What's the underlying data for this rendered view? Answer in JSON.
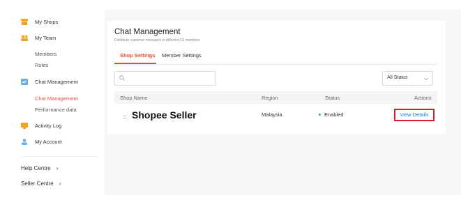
{
  "sidebar": {
    "items": [
      {
        "label": "My Shops",
        "icon": "shop-icon"
      },
      {
        "label": "My Team",
        "icon": "team-icon"
      },
      {
        "label": "Members"
      },
      {
        "label": "Roles"
      },
      {
        "label": "Chat Management",
        "icon": "chat-icon"
      },
      {
        "label": "Chat Management"
      },
      {
        "label": "Performance data"
      },
      {
        "label": "Activity Log",
        "icon": "activity-log-icon"
      },
      {
        "label": "My Account",
        "icon": "account-icon"
      }
    ],
    "help_centre": "Help Centre",
    "seller_centre": "Seller Centre",
    "chevron": "›"
  },
  "main": {
    "title": "Chat Management",
    "subtitle": "Distribute customer messages to different CS members",
    "tabs": [
      {
        "label": "Shop Settings"
      },
      {
        "label": "Member Settings"
      }
    ],
    "search": {
      "placeholder": "",
      "value": ""
    },
    "status_filter": {
      "selected": "All Status"
    },
    "table": {
      "columns": [
        "Shop Name",
        "Region",
        "Status",
        "Actions"
      ],
      "rows": [
        {
          "shop_name": "Shopee Seller",
          "region": "Malaysia",
          "status": "Enabled",
          "action": "View Details"
        }
      ]
    }
  },
  "colors": {
    "accent": "#ee4d2d",
    "highlight_border": "#e0192a",
    "link": "#0a7bdb",
    "status_enabled": "#26aa99"
  }
}
